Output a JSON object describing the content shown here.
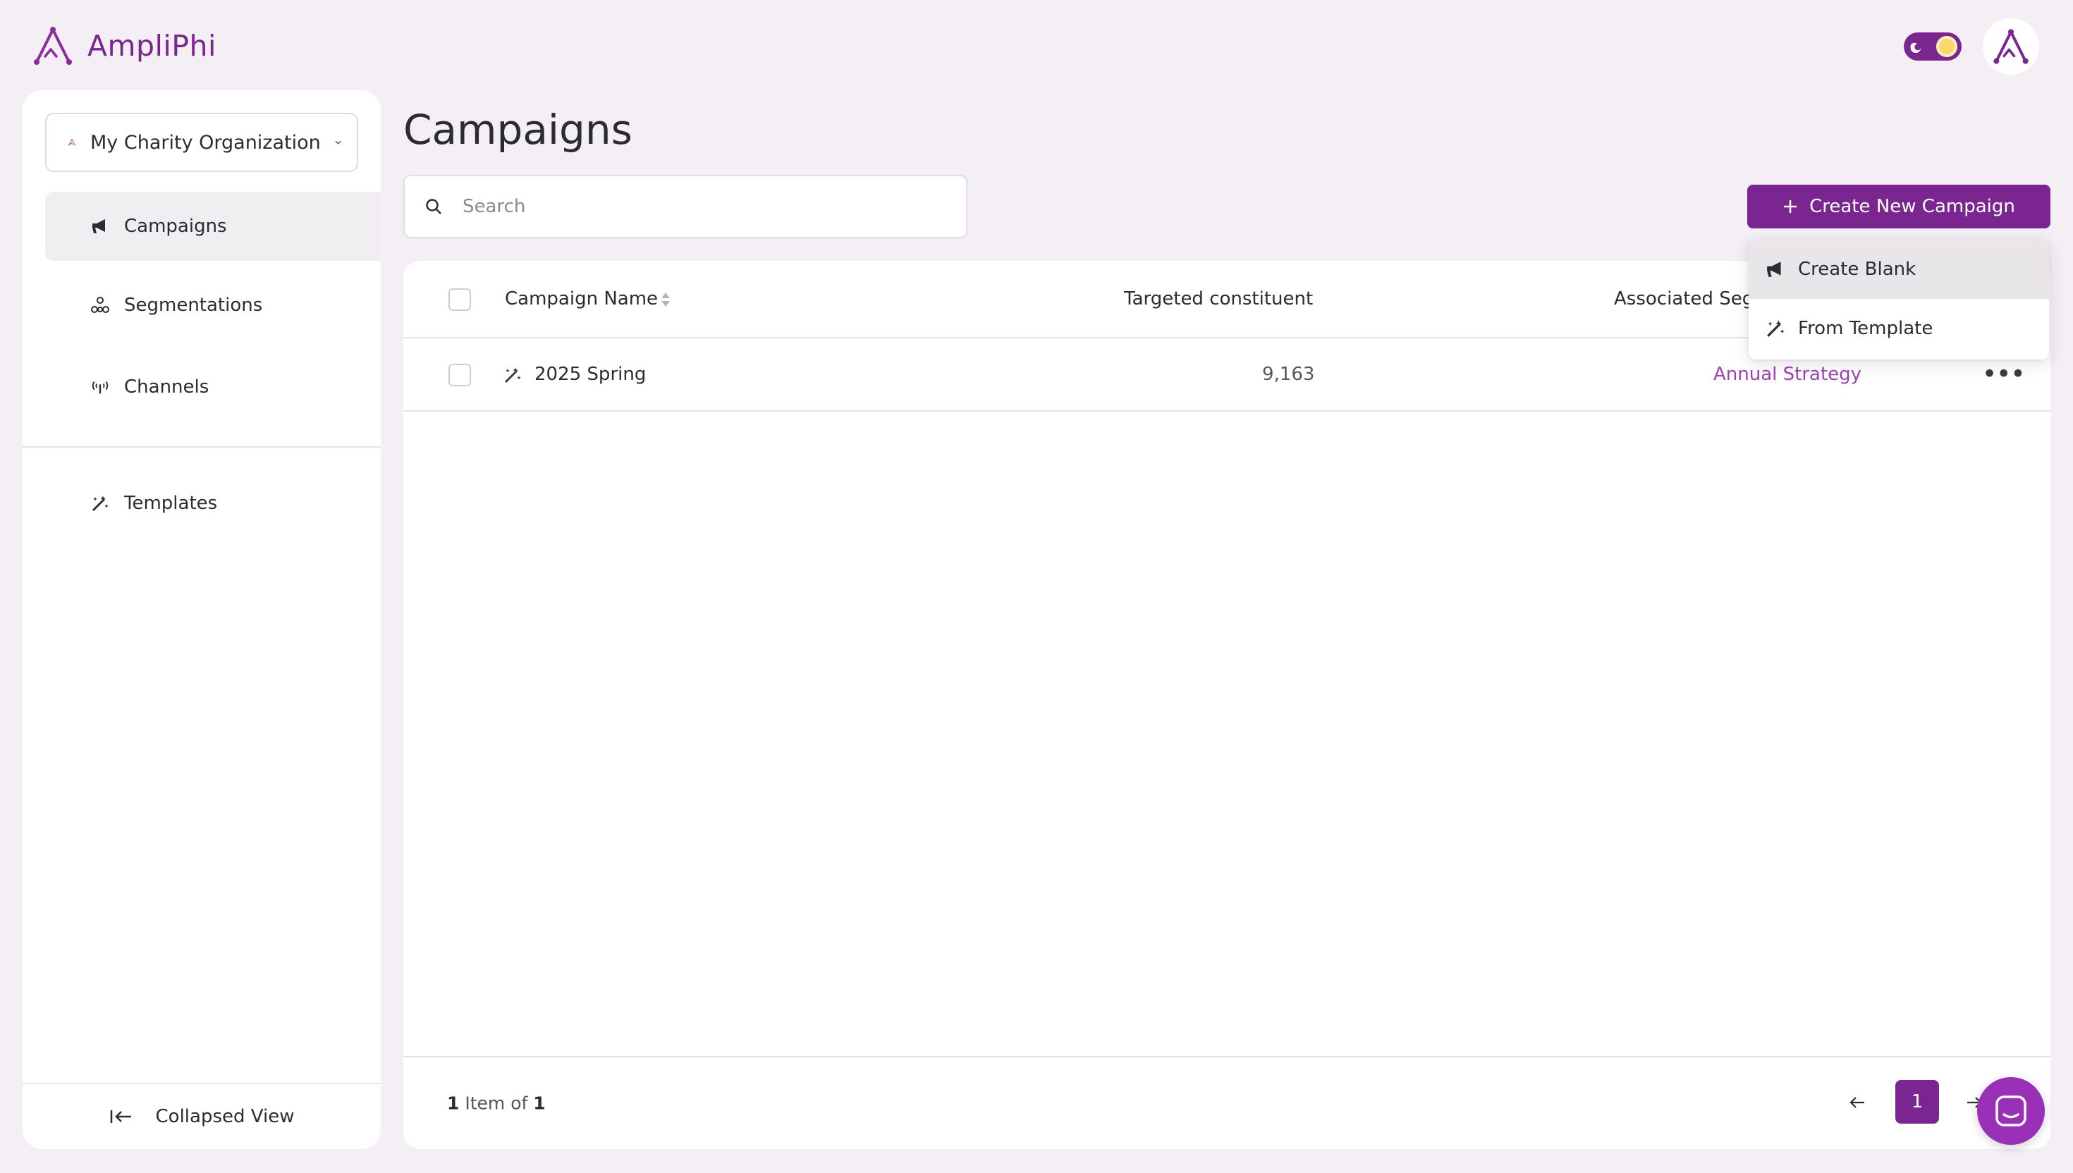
{
  "header": {
    "logo_text": "AmpliPhi",
    "theme_toggle": "light",
    "brand_color": "#7b2590"
  },
  "sidebar": {
    "org_name": "My Charity Organization",
    "items": [
      {
        "label": "Campaigns",
        "icon": "megaphone-icon",
        "active": true
      },
      {
        "label": "Segmentations",
        "icon": "segments-icon",
        "active": false
      },
      {
        "label": "Channels",
        "icon": "antenna-icon",
        "active": false
      },
      {
        "label": "Templates",
        "icon": "magic-wand-icon",
        "active": false
      }
    ],
    "collapse_label": "Collapsed View"
  },
  "main": {
    "title": "Campaigns",
    "search_placeholder": "Search",
    "create_button": "Create New Campaign",
    "dropdown": [
      {
        "label": "Create Blank",
        "icon": "megaphone-icon"
      },
      {
        "label": "From Template",
        "icon": "magic-wand-icon"
      }
    ],
    "table": {
      "columns": [
        "Campaign Name",
        "Targeted constituent",
        "Associated Seg"
      ],
      "rows": [
        {
          "name": "2025 Spring",
          "targeted": "9,163",
          "segment": "Annual Strategy"
        }
      ]
    },
    "footer": {
      "count_a": "1",
      "count_text": " Item of ",
      "count_b": "1",
      "page": "1"
    }
  }
}
